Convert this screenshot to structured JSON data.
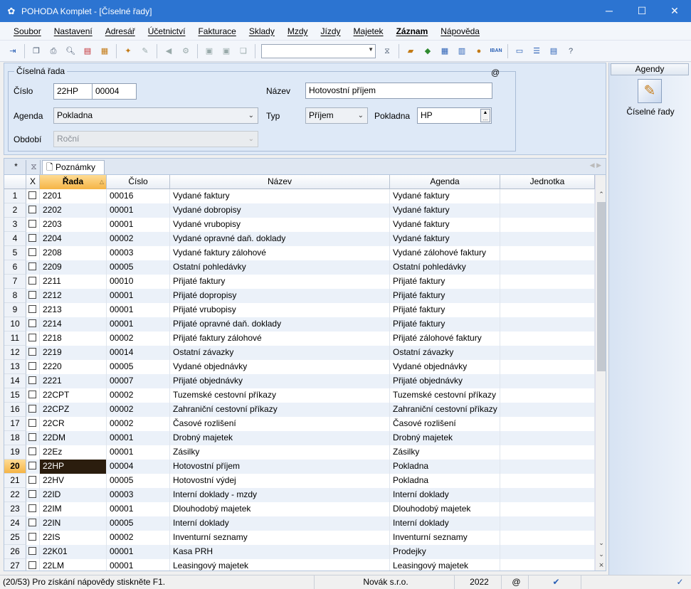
{
  "window": {
    "title": "POHODA Komplet - [Číselné řady]",
    "controls": {
      "minimize": "─",
      "maximize": "☐",
      "close": "✕"
    }
  },
  "menu": [
    "Soubor",
    "Nastavení",
    "Adresář",
    "Účetnictví",
    "Fakturace",
    "Sklady",
    "Mzdy",
    "Jízdy",
    "Majetek",
    "Záznam",
    "Nápověda"
  ],
  "menu_active": "Záznam",
  "toolbar": {
    "icons": [
      "exit-icon",
      "copy-icon",
      "print-icon",
      "print-preview-icon",
      "pdf-icon",
      "export-icon",
      "new-record-icon",
      "edit-icon",
      "back-arrow-icon",
      "settings-icon",
      "save-icon",
      "delete-icon",
      "copy-record-icon",
      "search-combo",
      "filter-icon",
      "folder-icon",
      "link-icon",
      "calculator-icon",
      "table-icon",
      "coins-icon",
      "iban-icon",
      "message-icon",
      "list-icon",
      "report-icon",
      "help-icon"
    ],
    "iban_label": "IBAN"
  },
  "form": {
    "group_title": "Číselná řada",
    "at_sign": "@",
    "cislo_label": "Číslo",
    "cislo_prefix": "22HP",
    "cislo_number": "00004",
    "nazev_label": "Název",
    "nazev_value": "Hotovostní příjem",
    "agenda_label": "Agenda",
    "agenda_value": "Pokladna",
    "typ_label": "Typ",
    "typ_value": "Příjem",
    "pokladna_label": "Pokladna",
    "pokladna_value": "HP",
    "obdobi_label": "Období",
    "obdobi_value": "Roční"
  },
  "right_panel": {
    "header": "Agendy",
    "item": "Číselné řady"
  },
  "tabs": {
    "star": "*",
    "note_tab": "Poznámky"
  },
  "table": {
    "columns": {
      "x": "X",
      "rada": "Řada",
      "cislo": "Číslo",
      "nazev": "Název",
      "agenda": "Agenda",
      "jednotka": "Jednotka"
    },
    "current_row": 20,
    "rows": [
      {
        "n": "1",
        "rada": "2201",
        "cislo": "00016",
        "nazev": "Vydané faktury",
        "agenda": "Vydané faktury"
      },
      {
        "n": "2",
        "rada": "2202",
        "cislo": "00001",
        "nazev": "Vydané dobropisy",
        "agenda": "Vydané faktury"
      },
      {
        "n": "3",
        "rada": "2203",
        "cislo": "00001",
        "nazev": "Vydané vrubopisy",
        "agenda": "Vydané faktury"
      },
      {
        "n": "4",
        "rada": "2204",
        "cislo": "00002",
        "nazev": "Vydané opravné daň. doklady",
        "agenda": "Vydané faktury"
      },
      {
        "n": "5",
        "rada": "2208",
        "cislo": "00003",
        "nazev": "Vydané faktury zálohové",
        "agenda": "Vydané zálohové faktury"
      },
      {
        "n": "6",
        "rada": "2209",
        "cislo": "00005",
        "nazev": "Ostatní pohledávky",
        "agenda": "Ostatní pohledávky"
      },
      {
        "n": "7",
        "rada": "2211",
        "cislo": "00010",
        "nazev": "Přijaté faktury",
        "agenda": "Přijaté faktury"
      },
      {
        "n": "8",
        "rada": "2212",
        "cislo": "00001",
        "nazev": "Přijaté dopropisy",
        "agenda": "Přijaté faktury"
      },
      {
        "n": "9",
        "rada": "2213",
        "cislo": "00001",
        "nazev": "Přijaté vrubopisy",
        "agenda": "Přijaté faktury"
      },
      {
        "n": "10",
        "rada": "2214",
        "cislo": "00001",
        "nazev": "Přijaté opravné daň. doklady",
        "agenda": "Přijaté faktury"
      },
      {
        "n": "11",
        "rada": "2218",
        "cislo": "00002",
        "nazev": "Přijaté faktury zálohové",
        "agenda": "Přijaté zálohové faktury"
      },
      {
        "n": "12",
        "rada": "2219",
        "cislo": "00014",
        "nazev": "Ostatní závazky",
        "agenda": "Ostatní závazky"
      },
      {
        "n": "13",
        "rada": "2220",
        "cislo": "00005",
        "nazev": "Vydané objednávky",
        "agenda": "Vydané objednávky"
      },
      {
        "n": "14",
        "rada": "2221",
        "cislo": "00007",
        "nazev": "Přijaté objednávky",
        "agenda": "Přijaté objednávky"
      },
      {
        "n": "15",
        "rada": "22CPT",
        "cislo": "00002",
        "nazev": "Tuzemské cestovní příkazy",
        "agenda": "Tuzemské cestovní příkazy"
      },
      {
        "n": "16",
        "rada": "22CPZ",
        "cislo": "00002",
        "nazev": "Zahraniční cestovní příkazy",
        "agenda": "Zahraniční cestovní příkazy"
      },
      {
        "n": "17",
        "rada": "22CR",
        "cislo": "00002",
        "nazev": "Časové rozlišení",
        "agenda": "Časové rozlišení"
      },
      {
        "n": "18",
        "rada": "22DM",
        "cislo": "00001",
        "nazev": "Drobný majetek",
        "agenda": "Drobný majetek"
      },
      {
        "n": "19",
        "rada": "22Ez",
        "cislo": "00001",
        "nazev": "Zásilky",
        "agenda": "Zásilky"
      },
      {
        "n": "20",
        "rada": "22HP",
        "cislo": "00004",
        "nazev": "Hotovostní příjem",
        "agenda": "Pokladna"
      },
      {
        "n": "21",
        "rada": "22HV",
        "cislo": "00005",
        "nazev": "Hotovostní výdej",
        "agenda": "Pokladna"
      },
      {
        "n": "22",
        "rada": "22ID",
        "cislo": "00003",
        "nazev": "Interní doklady - mzdy",
        "agenda": "Interní doklady"
      },
      {
        "n": "23",
        "rada": "22IM",
        "cislo": "00001",
        "nazev": "Dlouhodobý majetek",
        "agenda": "Dlouhodobý majetek"
      },
      {
        "n": "24",
        "rada": "22IN",
        "cislo": "00005",
        "nazev": "Interní doklady",
        "agenda": "Interní doklady"
      },
      {
        "n": "25",
        "rada": "22IS",
        "cislo": "00002",
        "nazev": "Inventurní seznamy",
        "agenda": "Inventurní seznamy"
      },
      {
        "n": "26",
        "rada": "22K01",
        "cislo": "00001",
        "nazev": "Kasa PRH",
        "agenda": "Prodejky"
      },
      {
        "n": "27",
        "rada": "22LM",
        "cislo": "00001",
        "nazev": "Leasingový majetek",
        "agenda": "Leasingový majetek"
      }
    ]
  },
  "status": {
    "record": "(20/53) Pro získání nápovědy stiskněte F1.",
    "user": "Novák s.r.o.",
    "year": "2022",
    "at": "@"
  }
}
